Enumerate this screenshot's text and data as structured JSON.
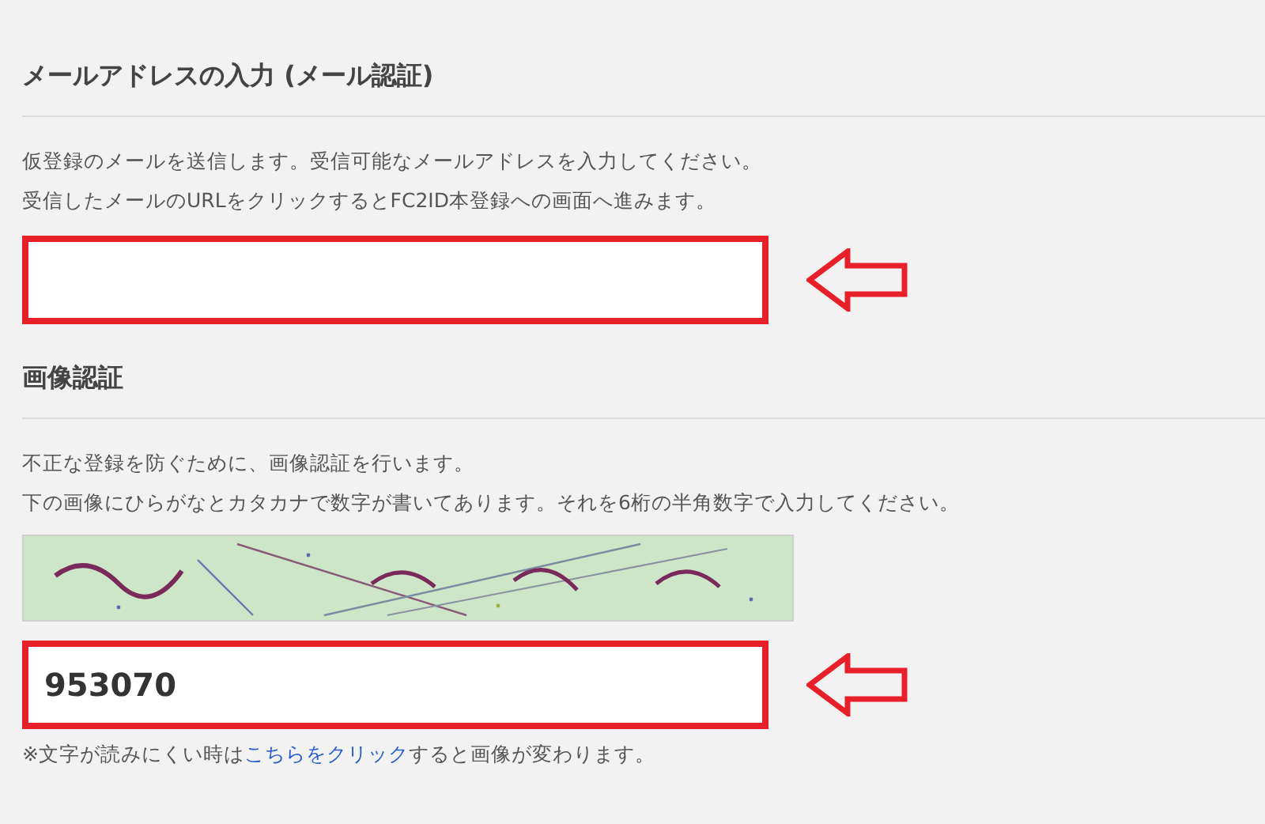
{
  "sections": [
    {
      "heading": "メールアドレスの入力 (メール認証)",
      "lines": [
        "仮登録のメールを送信します。受信可能なメールアドレスを入力してください。",
        "受信したメールのURLをクリックするとFC2ID本登録への画面へ進みます。"
      ],
      "field": {
        "highlighted": true
      }
    },
    {
      "heading": "画像認証",
      "lines": [
        "不正な登録を防ぐために、画像認証を行います。",
        "下の画像にひらがなとカタカナで数字が書いてあります。それを6桁の半角数字で入力してください。"
      ],
      "field": {
        "value": "953070",
        "highlighted": true
      },
      "note": {
        "before": "※文字が読みにくい時は",
        "link": "こちらをクリック",
        "after": "すると画像が変わります。"
      }
    }
  ]
}
